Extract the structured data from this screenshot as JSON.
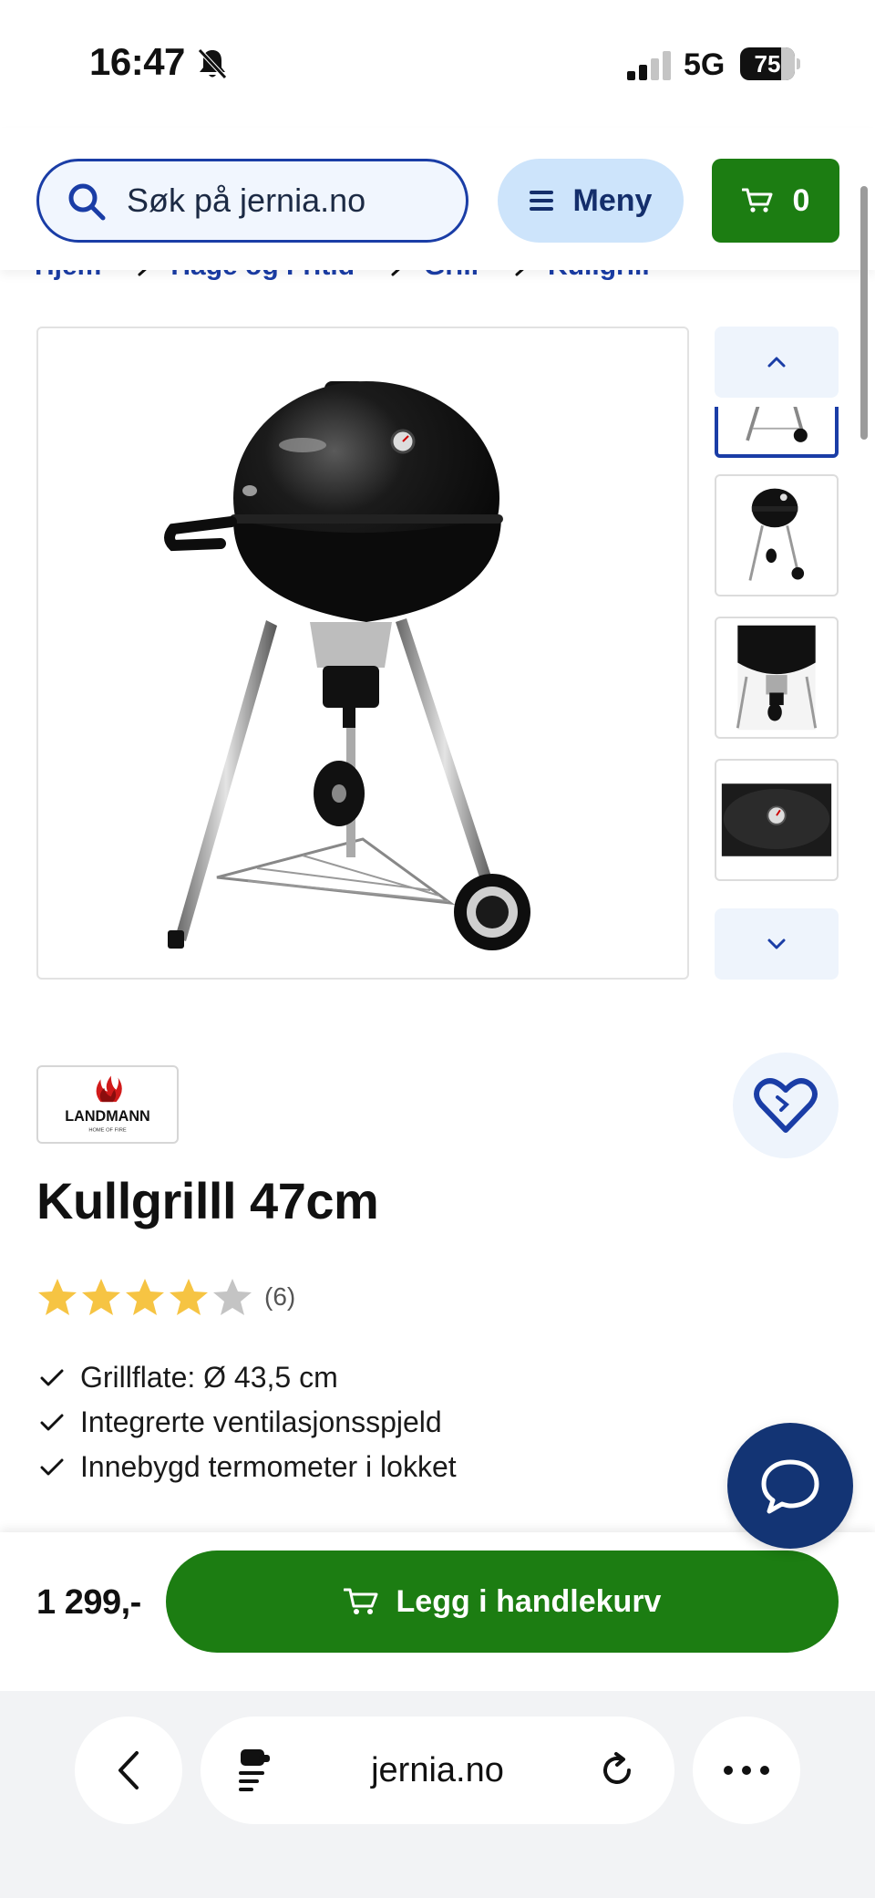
{
  "status_bar": {
    "time": "16:47",
    "network": "5G",
    "battery_percent": 75,
    "battery_label": "75"
  },
  "header": {
    "search_placeholder": "Søk på jernia.no",
    "menu_label": "Meny",
    "cart_count": "0"
  },
  "breadcrumb": {
    "items": [
      "Hjem",
      "Hage og Fritid",
      "Grill",
      "Kullgrill"
    ]
  },
  "gallery": {
    "thumbnail_count_visible": 4,
    "active_thumbnail": 1
  },
  "product": {
    "brand": "LANDMANN",
    "brand_tagline": "HOME OF FIRE",
    "title": "Kullgrilll 47cm",
    "rating": 4,
    "rating_max": 5,
    "review_count": "(6)",
    "features": [
      "Grillflate: Ø 43,5 cm",
      "Integrerte ventilasjonsspjeld",
      "Innebygd termometer i lokket"
    ]
  },
  "buy_bar": {
    "price": "1 299,-",
    "add_to_cart_label": "Legg i handlekurv"
  },
  "browser": {
    "url": "jernia.no"
  },
  "colors": {
    "brand_blue": "#1a3da6",
    "navy": "#133474",
    "green": "#1c7d12",
    "light_blue": "#cde4fb",
    "star": "#f6c443",
    "star_empty": "#c4c4c4"
  },
  "icons": [
    "bell-slash-icon",
    "signal-icon",
    "search-icon",
    "menu-icon",
    "cart-icon",
    "arrow-right-icon",
    "chevron-up-icon",
    "chevron-down-icon",
    "heart-icon",
    "star-icon",
    "check-icon",
    "chat-icon",
    "back-icon",
    "reader-icon",
    "reload-icon",
    "more-icon"
  ]
}
